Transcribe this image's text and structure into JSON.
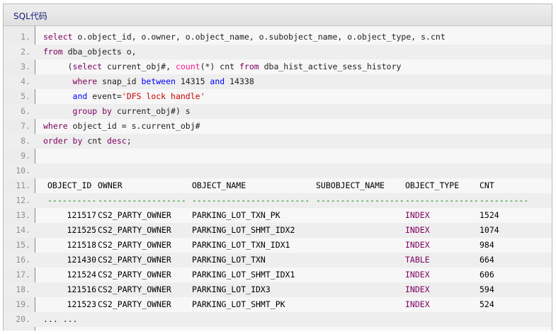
{
  "title": "SQL代码",
  "lines": [
    {
      "n": "1.",
      "tokens": [
        [
          "k",
          "select"
        ],
        [
          "t",
          " o.object_id, o.owner, o.object_name, o.subobject_name, o.object_type, s.cnt"
        ]
      ]
    },
    {
      "n": "2.",
      "tokens": [
        [
          "k",
          "from"
        ],
        [
          "t",
          " dba_objects o,"
        ]
      ]
    },
    {
      "n": "3.",
      "tokens": [
        [
          "t",
          "     ("
        ],
        [
          "k",
          "select"
        ],
        [
          "t",
          " current_obj#, "
        ],
        [
          "f",
          "count"
        ],
        [
          "t",
          "(*) cnt "
        ],
        [
          "k",
          "from"
        ],
        [
          "t",
          " dba_hist_active_sess_history"
        ]
      ]
    },
    {
      "n": "4.",
      "tokens": [
        [
          "t",
          "      "
        ],
        [
          "k",
          "where"
        ],
        [
          "t",
          " snap_id "
        ],
        [
          "b",
          "between"
        ],
        [
          "t",
          " 14315 "
        ],
        [
          "b",
          "and"
        ],
        [
          "t",
          " 14338"
        ]
      ]
    },
    {
      "n": "5.",
      "tokens": [
        [
          "t",
          "      "
        ],
        [
          "b",
          "and"
        ],
        [
          "t",
          " event="
        ],
        [
          "s",
          "'DFS lock handle'"
        ]
      ]
    },
    {
      "n": "6.",
      "tokens": [
        [
          "t",
          "      "
        ],
        [
          "k",
          "group by"
        ],
        [
          "t",
          " current_obj#) s"
        ]
      ]
    },
    {
      "n": "7.",
      "tokens": [
        [
          "k",
          "where"
        ],
        [
          "t",
          " object_id = s.current_obj#"
        ]
      ]
    },
    {
      "n": "8.",
      "tokens": [
        [
          "k",
          "order by"
        ],
        [
          "t",
          " cnt "
        ],
        [
          "k",
          "desc"
        ],
        [
          "t",
          ";"
        ]
      ]
    },
    {
      "n": "9.",
      "tokens": []
    },
    {
      "n": "10.",
      "tokens": []
    }
  ],
  "result": {
    "header_num": "11.",
    "headers": [
      "OBJECT_ID",
      "OWNER",
      "OBJECT_NAME",
      "SUBOBJECT_NAME",
      "OBJECT_TYPE",
      "CNT"
    ],
    "separator_num": "12.",
    "separators": [
      "----------",
      "------------------",
      "------------------------",
      "------------------",
      "---------------",
      "----------"
    ],
    "rows": [
      {
        "n": "13.",
        "cells": [
          "121517",
          "CS2_PARTY_OWNER",
          "PARKING_LOT_TXN_PK",
          "",
          "INDEX",
          "1524"
        ]
      },
      {
        "n": "14.",
        "cells": [
          "121525",
          "CS2_PARTY_OWNER",
          "PARKING_LOT_SHMT_IDX2",
          "",
          "INDEX",
          "1074"
        ]
      },
      {
        "n": "15.",
        "cells": [
          "121518",
          "CS2_PARTY_OWNER",
          "PARKING_LOT_TXN_IDX1",
          "",
          "INDEX",
          "984"
        ]
      },
      {
        "n": "16.",
        "cells": [
          "121430",
          "CS2_PARTY_OWNER",
          "PARKING_LOT_TXN",
          "",
          "TABLE",
          "664"
        ]
      },
      {
        "n": "17.",
        "cells": [
          "121524",
          "CS2_PARTY_OWNER",
          "PARKING_LOT_SHMT_IDX1",
          "",
          "INDEX",
          "606"
        ]
      },
      {
        "n": "18.",
        "cells": [
          "121516",
          "CS2_PARTY_OWNER",
          "PARKING_LOT_IDX3",
          "",
          "INDEX",
          "594"
        ]
      },
      {
        "n": "19.",
        "cells": [
          "121523",
          "CS2_PARTY_OWNER",
          "PARKING_LOT_SHMT_PK",
          "",
          "INDEX",
          "524"
        ]
      }
    ],
    "footer": {
      "n": "20.",
      "text": "... ..."
    }
  }
}
